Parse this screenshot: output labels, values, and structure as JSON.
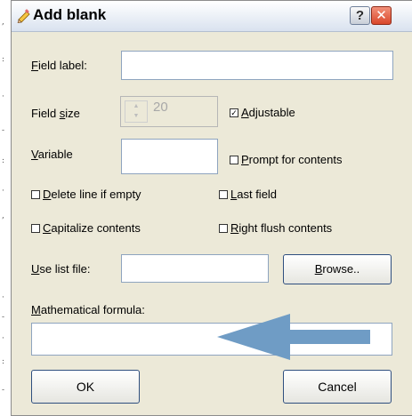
{
  "window": {
    "title": "Add blank",
    "help_label": "?",
    "close_label": "✕"
  },
  "form": {
    "field_label": {
      "prefix": "",
      "key": "F",
      "rest": "ield label:",
      "value": ""
    },
    "field_size": {
      "prefix": "Field ",
      "key": "s",
      "rest": "ize",
      "value": "20",
      "enabled": false
    },
    "adjustable": {
      "prefix": "",
      "key": "A",
      "rest": "djustable",
      "checked": true
    },
    "variable": {
      "prefix": "",
      "key": "V",
      "rest": "ariable",
      "value": ""
    },
    "prompt": {
      "prefix": "",
      "key": "P",
      "rest": "rompt for contents",
      "checked": false
    },
    "delete_line": {
      "prefix": "",
      "key": "D",
      "rest": "elete line if empty",
      "checked": false
    },
    "last_field": {
      "prefix": "",
      "key": "L",
      "rest": "ast field",
      "checked": false
    },
    "capitalize": {
      "prefix": "",
      "key": "C",
      "rest": "apitalize contents",
      "checked": false
    },
    "right_flush": {
      "prefix": "",
      "key": "R",
      "rest": "ight flush contents",
      "checked": false
    },
    "list_file": {
      "prefix": "",
      "key": "U",
      "rest": "se list file:",
      "value": ""
    },
    "browse": {
      "prefix": "",
      "key": "B",
      "rest": "rowse.."
    },
    "formula": {
      "prefix": "",
      "key": "M",
      "rest": "athematical formula:",
      "value": ""
    }
  },
  "buttons": {
    "ok": "OK",
    "cancel": "Cancel"
  },
  "colors": {
    "arrow": "#6f9cc5",
    "dialog_bg": "#ece9d8",
    "close_button": "#d9472b"
  },
  "icons": {
    "title": "pencil-icon",
    "overlay": "left-arrow-icon"
  }
}
